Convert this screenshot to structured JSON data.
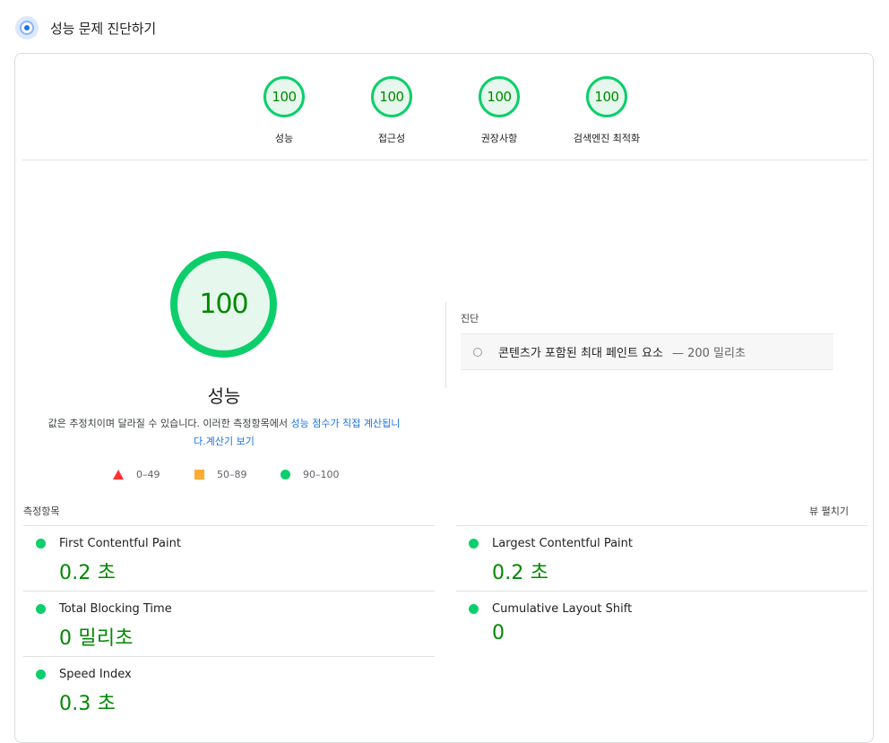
{
  "header": {
    "title": "성능 문제 진단하기",
    "icon": "lighthouse-icon"
  },
  "categories": [
    {
      "score": "100",
      "label": "성능"
    },
    {
      "score": "100",
      "label": "접근성"
    },
    {
      "score": "100",
      "label": "권장사항"
    },
    {
      "score": "100",
      "label": "검색엔진 최적화"
    }
  ],
  "performance": {
    "score": "100",
    "label": "성능",
    "description": "값은 추정치이며 달라질 수 있습니다. 이러한 측정항목에서",
    "link_text": "성능 점수가 직접 계산됩니다.",
    "calculator_link": "계산기 보기"
  },
  "legend": [
    {
      "shape": "triangle",
      "range": "0–49",
      "color": "#ff3333"
    },
    {
      "shape": "square",
      "range": "50–89",
      "color": "#ffaa33"
    },
    {
      "shape": "circle",
      "range": "90–100",
      "color": "#0cce6b"
    }
  ],
  "diagnostics": {
    "title": "진단",
    "items": [
      {
        "name": "콘텐츠가 포함된 최대 페인트 요소",
        "value": "— 200 밀리초"
      }
    ]
  },
  "metrics": {
    "title": "측정항목",
    "expand_label": "뷰 펼치기",
    "items": [
      {
        "name": "First Contentful Paint",
        "value": "0.2 초"
      },
      {
        "name": "Largest Contentful Paint",
        "value": "0.2 초"
      },
      {
        "name": "Total Blocking Time",
        "value": "0 밀리초"
      },
      {
        "name": "Cumulative Layout Shift",
        "value": "0"
      },
      {
        "name": "Speed Index",
        "value": "0.3 초"
      }
    ]
  },
  "colors": {
    "pass": "#0cce6b",
    "pass_text": "#008800",
    "link": "#1a73e8"
  }
}
